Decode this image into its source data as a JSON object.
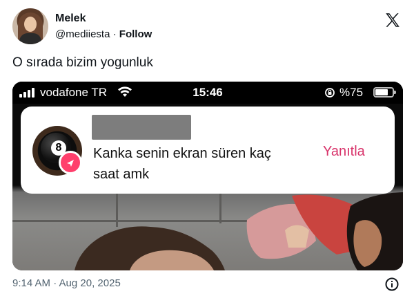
{
  "author": {
    "name": "Melek",
    "handle": "@mediiesta",
    "separator": "·",
    "follow_label": "Follow"
  },
  "tweet": {
    "text": "O sırada bizim yogunluk",
    "timestamp": "9:14 AM · Aug 20, 2025"
  },
  "screenshot": {
    "status_bar": {
      "carrier": "vodafone TR",
      "time": "15:46",
      "battery_label": "%75",
      "battery_level": 0.75
    },
    "notification": {
      "message": "Kanka senin ekran süren kaç saat amk",
      "reply_label": "Yanıtla",
      "avatar_number": "8"
    }
  },
  "colors": {
    "reply_accent": "#d8336a",
    "badge": "#ff3f6c"
  },
  "icons": [
    "x-logo-icon",
    "signal-icon",
    "wifi-icon",
    "rotation-lock-icon",
    "battery-icon",
    "send-icon",
    "info-icon"
  ]
}
